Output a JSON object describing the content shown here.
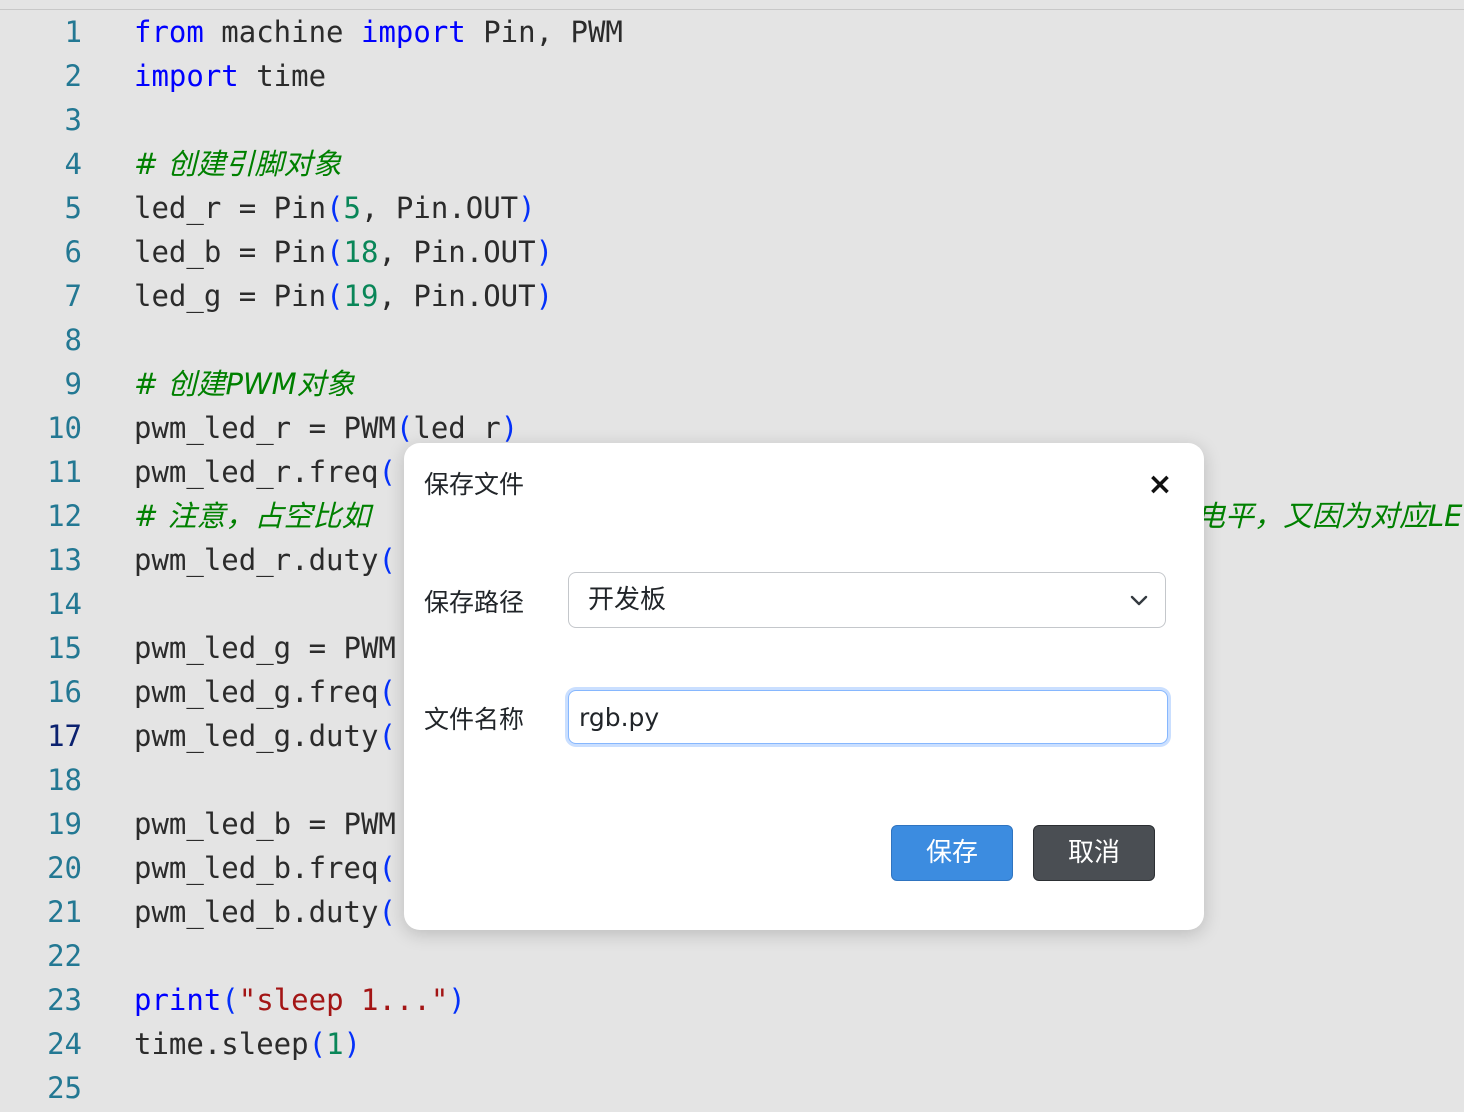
{
  "editor": {
    "lines": [
      {
        "n": "1",
        "parts": [
          {
            "t": "from",
            "c": "kw"
          },
          {
            "t": " machine ",
            "c": ""
          },
          {
            "t": "import",
            "c": "kw"
          },
          {
            "t": " Pin, PWM",
            "c": ""
          }
        ]
      },
      {
        "n": "2",
        "parts": [
          {
            "t": "import",
            "c": "kw"
          },
          {
            "t": " time",
            "c": ""
          }
        ]
      },
      {
        "n": "3",
        "parts": []
      },
      {
        "n": "4",
        "parts": [
          {
            "t": "# 创建引脚对象",
            "c": "cm"
          }
        ]
      },
      {
        "n": "5",
        "parts": [
          {
            "t": "led_r = Pin",
            "c": ""
          },
          {
            "t": "(",
            "c": "br"
          },
          {
            "t": "5",
            "c": "num"
          },
          {
            "t": ", Pin.OUT",
            "c": ""
          },
          {
            "t": ")",
            "c": "br"
          }
        ]
      },
      {
        "n": "6",
        "parts": [
          {
            "t": "led_b = Pin",
            "c": ""
          },
          {
            "t": "(",
            "c": "br"
          },
          {
            "t": "18",
            "c": "num"
          },
          {
            "t": ", Pin.OUT",
            "c": ""
          },
          {
            "t": ")",
            "c": "br"
          }
        ]
      },
      {
        "n": "7",
        "parts": [
          {
            "t": "led_g = Pin",
            "c": ""
          },
          {
            "t": "(",
            "c": "br"
          },
          {
            "t": "19",
            "c": "num"
          },
          {
            "t": ", Pin.OUT",
            "c": ""
          },
          {
            "t": ")",
            "c": "br"
          }
        ]
      },
      {
        "n": "8",
        "parts": []
      },
      {
        "n": "9",
        "parts": [
          {
            "t": "# 创建PWM对象",
            "c": "cm"
          }
        ]
      },
      {
        "n": "10",
        "parts": [
          {
            "t": "pwm_led_r = PWM",
            "c": ""
          },
          {
            "t": "(",
            "c": "br"
          },
          {
            "t": "led_r",
            "c": ""
          },
          {
            "t": ")",
            "c": "br"
          }
        ]
      },
      {
        "n": "11",
        "parts": [
          {
            "t": "pwm_led_r.freq",
            "c": ""
          },
          {
            "t": "(",
            "c": "br"
          }
        ]
      },
      {
        "n": "12",
        "parts": [
          {
            "t": "# 注意，占空比如",
            "c": "cm"
          }
        ]
      },
      {
        "n": "13",
        "parts": [
          {
            "t": "pwm_led_r.duty",
            "c": ""
          },
          {
            "t": "(",
            "c": "br"
          }
        ]
      },
      {
        "n": "14",
        "parts": []
      },
      {
        "n": "15",
        "parts": [
          {
            "t": "pwm_led_g = PWM",
            "c": ""
          }
        ]
      },
      {
        "n": "16",
        "parts": [
          {
            "t": "pwm_led_g.freq",
            "c": ""
          },
          {
            "t": "(",
            "c": "br"
          }
        ]
      },
      {
        "n": "17",
        "parts": [
          {
            "t": "pwm_led_g.duty",
            "c": ""
          },
          {
            "t": "(",
            "c": "br"
          }
        ]
      },
      {
        "n": "18",
        "parts": []
      },
      {
        "n": "19",
        "parts": [
          {
            "t": "pwm_led_b = PWM",
            "c": ""
          }
        ]
      },
      {
        "n": "20",
        "parts": [
          {
            "t": "pwm_led_b.freq",
            "c": ""
          },
          {
            "t": "(",
            "c": "br"
          }
        ]
      },
      {
        "n": "21",
        "parts": [
          {
            "t": "pwm_led_b.duty",
            "c": ""
          },
          {
            "t": "(",
            "c": "br"
          }
        ]
      },
      {
        "n": "22",
        "parts": []
      },
      {
        "n": "23",
        "parts": [
          {
            "t": "print",
            "c": "kw"
          },
          {
            "t": "(",
            "c": "br"
          },
          {
            "t": "\"sleep 1...\"",
            "c": "str"
          },
          {
            "t": ")",
            "c": "br"
          }
        ]
      },
      {
        "n": "24",
        "parts": [
          {
            "t": "time.sleep",
            "c": ""
          },
          {
            "t": "(",
            "c": "br"
          },
          {
            "t": "1",
            "c": "num"
          },
          {
            "t": ")",
            "c": "br"
          }
        ]
      },
      {
        "n": "25",
        "parts": []
      }
    ],
    "active_line": "17",
    "line12_tail": "电平，又因为对应LE"
  },
  "dialog": {
    "title": "保存文件",
    "close_icon": "×",
    "path_label": "保存路径",
    "path_value": "开发板",
    "name_label": "文件名称",
    "name_value": "rgb.py",
    "save_label": "保存",
    "cancel_label": "取消"
  },
  "colors": {
    "keyword": "#0000ff",
    "number": "#098658",
    "string": "#a31515",
    "comment": "#008000",
    "line_number": "#237893",
    "save_button": "#3c8ce0",
    "cancel_button": "#4a4e53"
  }
}
